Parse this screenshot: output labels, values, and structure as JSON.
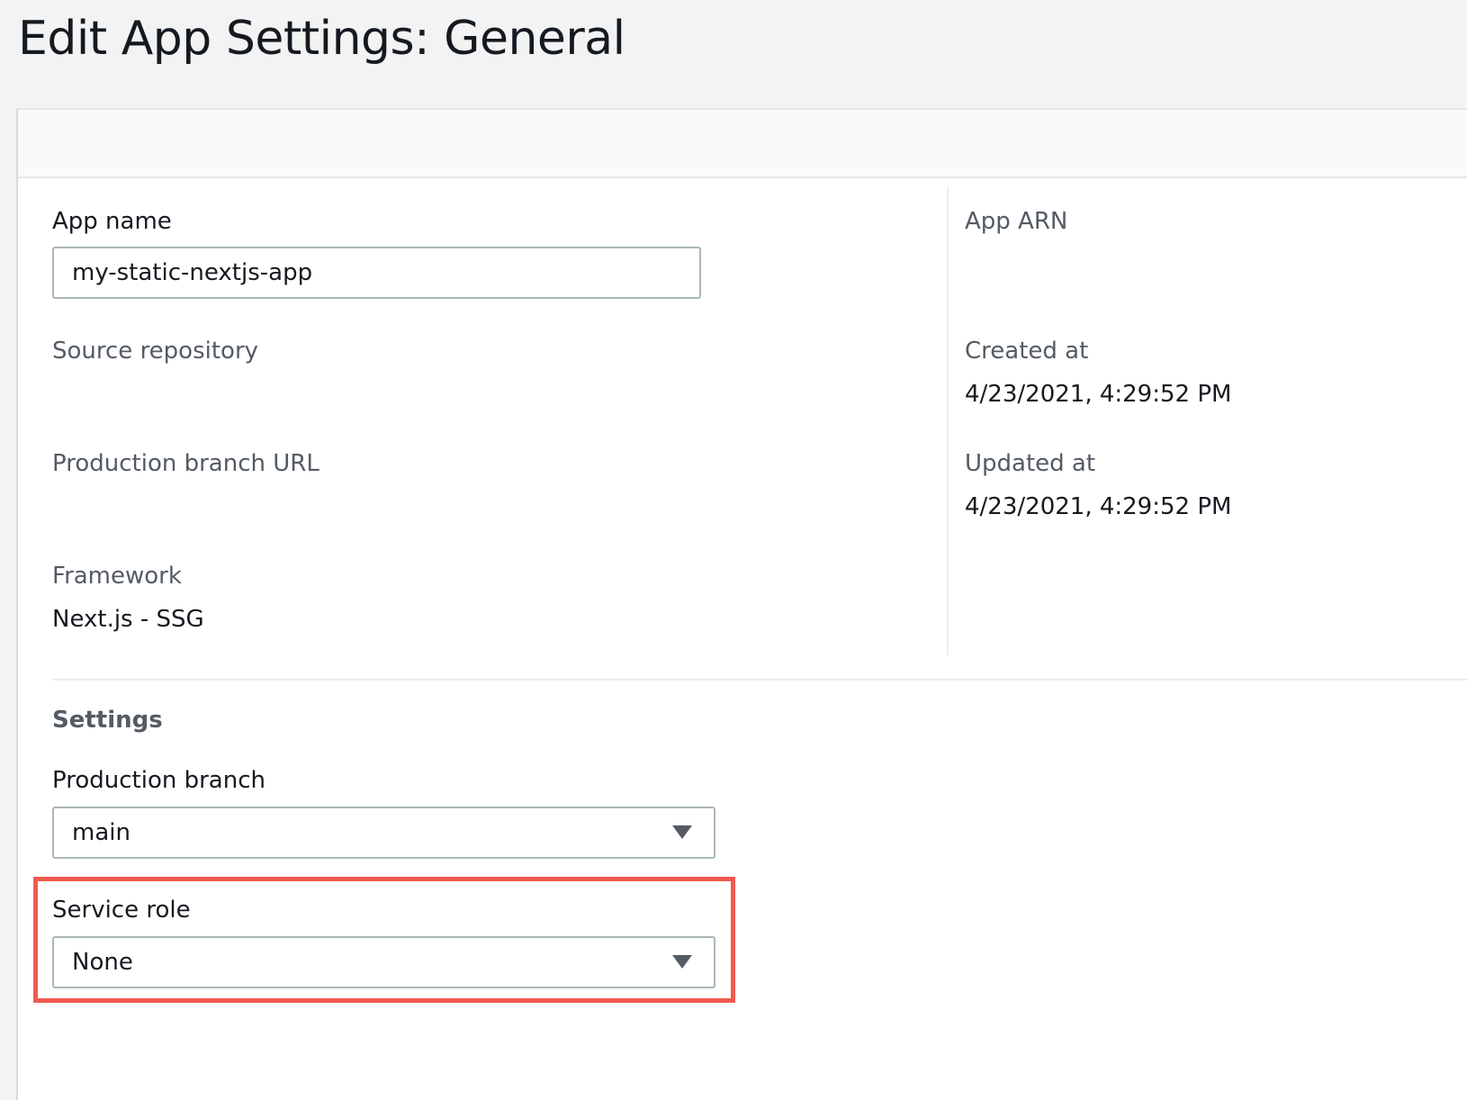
{
  "page": {
    "title": "Edit App Settings: General"
  },
  "general": {
    "app_name_label": "App name",
    "app_name_value": "my-static-nextjs-app",
    "source_repository_label": "Source repository",
    "production_branch_url_label": "Production branch URL",
    "framework_label": "Framework",
    "framework_value": "Next.js - SSG"
  },
  "details": {
    "app_arn_label": "App ARN",
    "created_at_label": "Created at",
    "created_at_value": "4/23/2021, 4:29:52 PM",
    "updated_at_label": "Updated at",
    "updated_at_value": "4/23/2021, 4:29:52 PM"
  },
  "settings": {
    "heading": "Settings",
    "production_branch_label": "Production branch",
    "production_branch_value": "main",
    "service_role_label": "Service role",
    "service_role_value": "None"
  },
  "colors": {
    "highlight": "#f25a50",
    "page_background": "#f2f3f3",
    "input_border": "#aab7b8"
  },
  "icons": {
    "dropdown": "chevron-down-icon"
  }
}
